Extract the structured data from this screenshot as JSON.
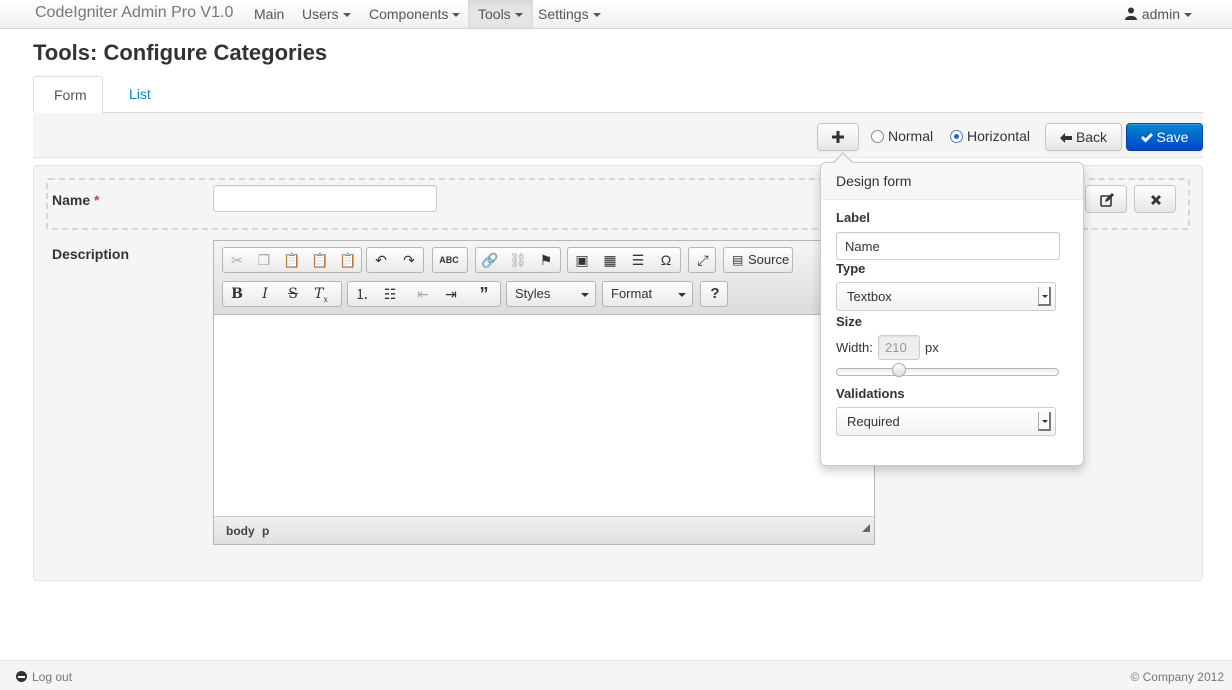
{
  "navbar": {
    "brand": "CodeIgniter Admin Pro V1.0",
    "items": [
      {
        "label": "Main"
      },
      {
        "label": "Users"
      },
      {
        "label": "Components"
      },
      {
        "label": "Tools"
      },
      {
        "label": "Settings"
      }
    ],
    "active_item": "Tools",
    "user": "admin"
  },
  "page": {
    "title": "Tools: Configure Categories",
    "tabs": [
      {
        "label": "Form"
      },
      {
        "label": "List"
      }
    ],
    "active_tab": "Form"
  },
  "toolbar": {
    "add_icon": "plus-icon",
    "layout_options": [
      {
        "label": "Normal",
        "checked": false
      },
      {
        "label": "Horizontal",
        "checked": true
      }
    ],
    "back_label": "Back",
    "save_label": "Save"
  },
  "form": {
    "name_label": "Name",
    "name_required_mark": "*",
    "name_value": "",
    "description_label": "Description",
    "editor": {
      "source_label": "Source",
      "styles_label": "Styles",
      "format_label": "Format",
      "help_label": "?",
      "status_path": [
        "body",
        "p"
      ],
      "content": ""
    }
  },
  "design_form": {
    "title": "Design form",
    "label_heading": "Label",
    "label_value": "Name",
    "type_heading": "Type",
    "type_value": "Textbox",
    "size_heading": "Size",
    "width_label": "Width:",
    "width_value": "210",
    "width_unit": "px",
    "slider_fraction": 0.27,
    "validations_heading": "Validations",
    "validations_value": "Required"
  },
  "footer": {
    "logout_label": "Log out",
    "copyright": "© Company 2012"
  },
  "colors": {
    "primary": "#0088cc",
    "link": "#0088cc",
    "required": "#b94a48"
  }
}
